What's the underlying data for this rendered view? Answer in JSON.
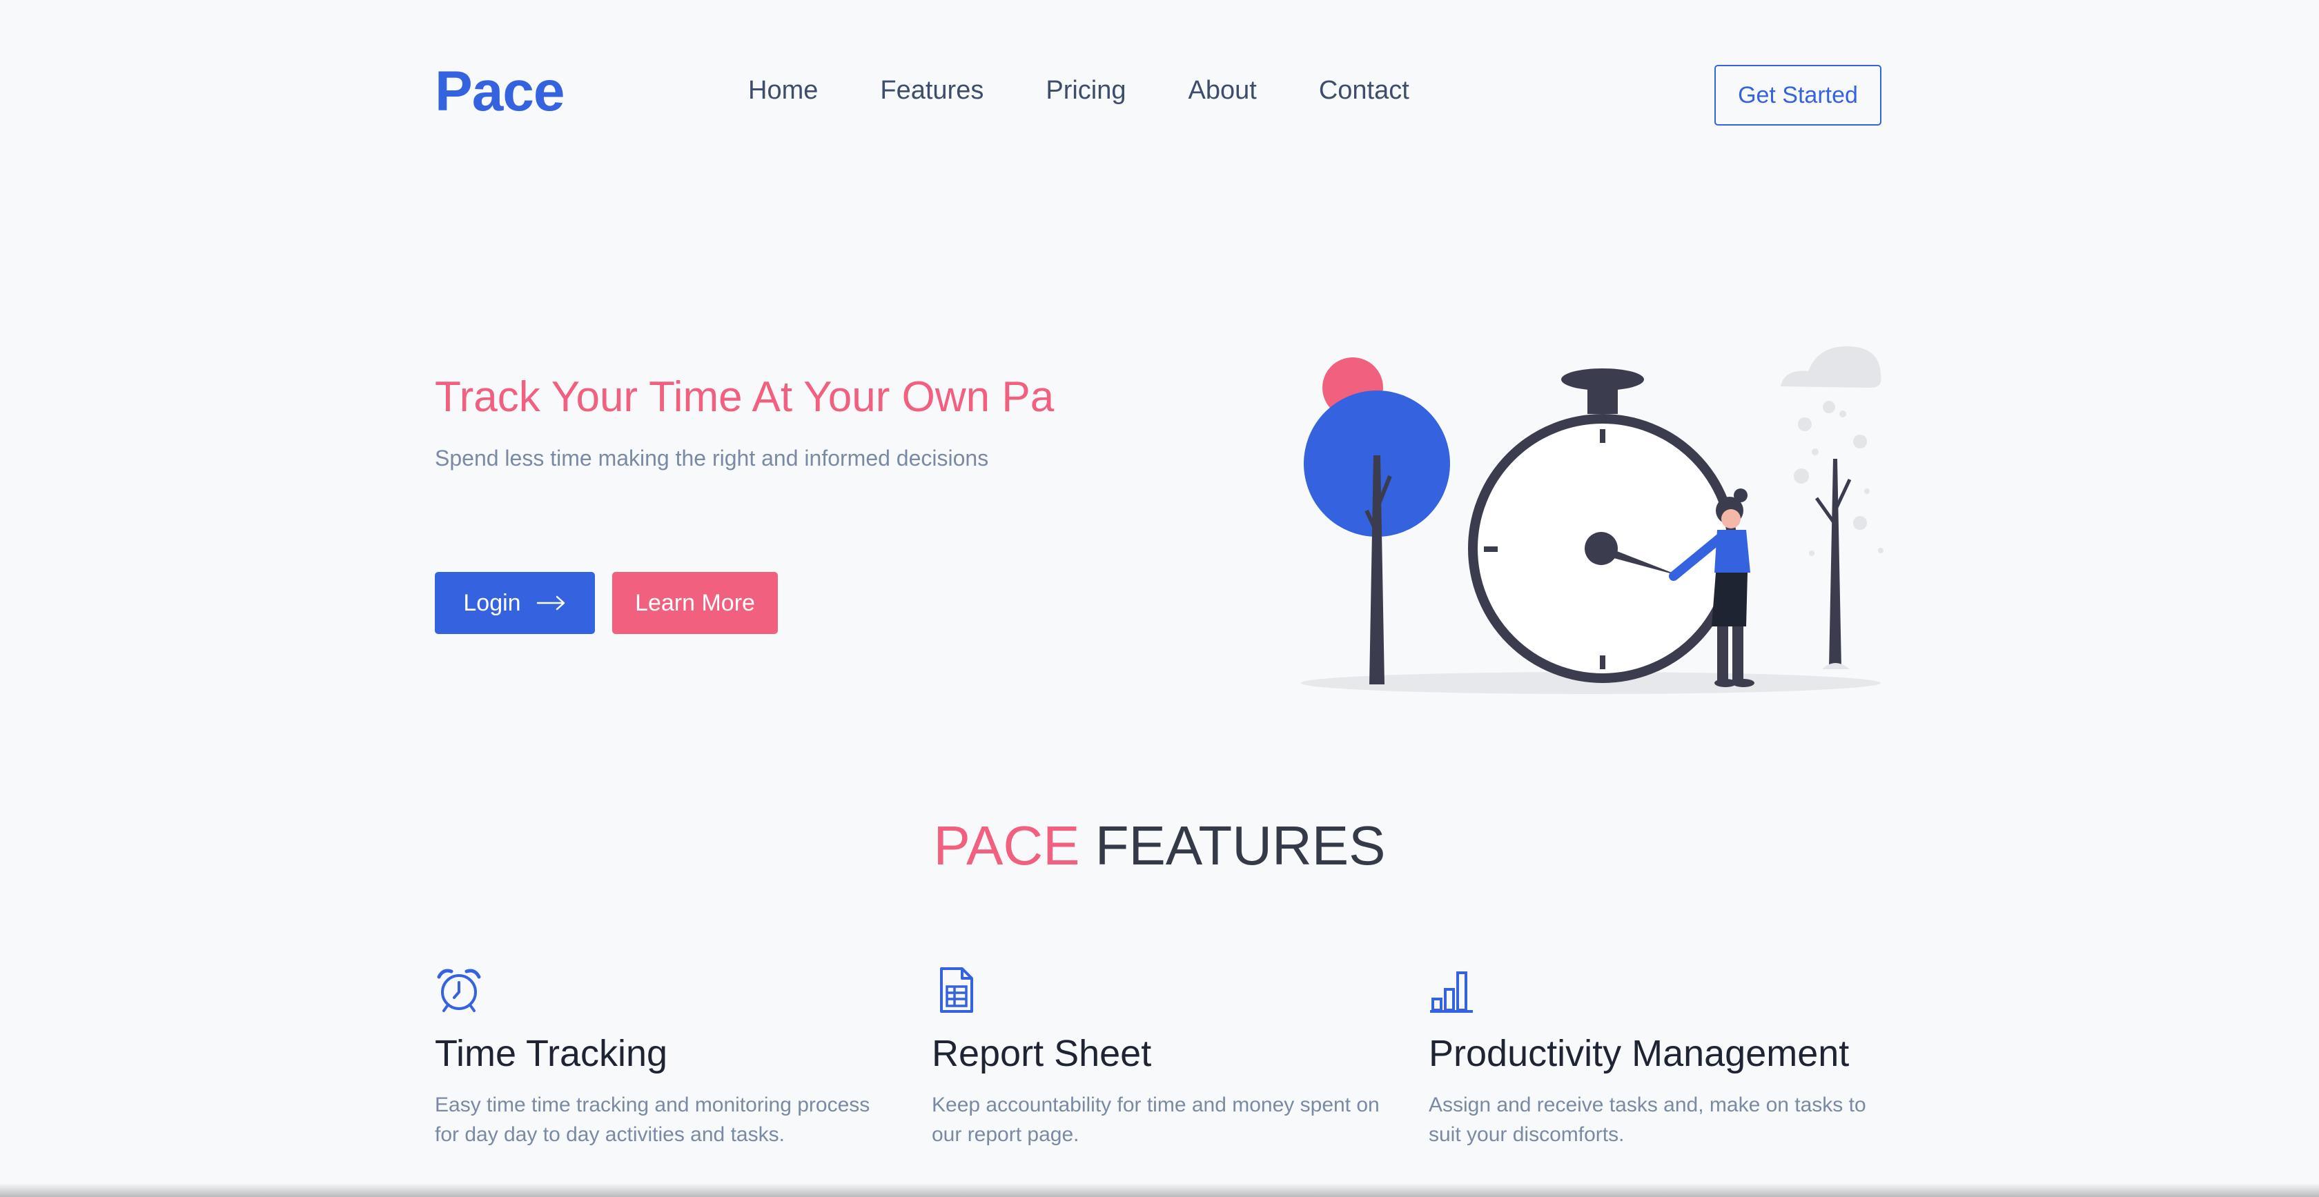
{
  "header": {
    "logo": "Pace",
    "nav": [
      "Home",
      "Features",
      "Pricing",
      "About",
      "Contact"
    ],
    "cta_label": "Get Started"
  },
  "hero": {
    "title": "Track Your Time At Your Own Pa",
    "subtitle": "Spend less time making the right and informed decisions",
    "login_label": "Login",
    "learn_more_label": "Learn More"
  },
  "features": {
    "title_accent": "PACE",
    "title_rest": "FEATURES",
    "items": [
      {
        "icon": "alarm-clock-icon",
        "title": "Time Tracking",
        "desc": "Easy time time tracking and monitoring process for day day to day activities and tasks."
      },
      {
        "icon": "spreadsheet-icon",
        "title": "Report Sheet",
        "desc": "Keep accountability for time and money spent on our report page."
      },
      {
        "icon": "bar-chart-icon",
        "title": "Productivity Management",
        "desc": "Assign and receive tasks and, make on tasks to suit your discomforts."
      }
    ]
  },
  "colors": {
    "primary": "#3563e0",
    "accent": "#f2607f",
    "background": "#f7f9fb",
    "text_muted": "#7a8aa4"
  }
}
